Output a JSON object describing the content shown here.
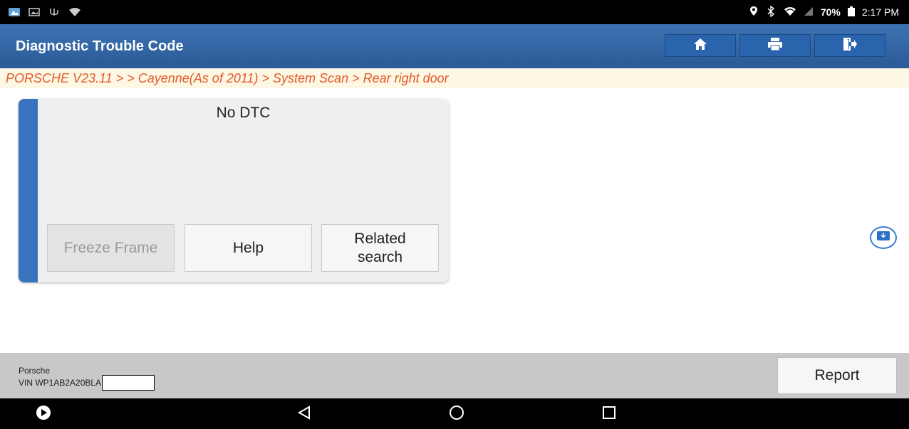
{
  "status_bar": {
    "battery": "70%",
    "time": "2:17 PM"
  },
  "title_bar": {
    "title": "Diagnostic Trouble Code",
    "buttons": [
      "home-icon",
      "print-icon",
      "exit-icon"
    ]
  },
  "breadcrumb": {
    "text": "PORSCHE V23.11 >  > Cayenne(As of 2011) > System Scan > Rear right door"
  },
  "dtc_card": {
    "title": "No DTC",
    "buttons": {
      "freeze_frame": "Freeze Frame",
      "help": "Help",
      "related_search": "Related search"
    },
    "accent_color": "#3a73bd"
  },
  "footer": {
    "make": "Porsche",
    "vin_prefix": "VIN WP1AB2A20BLA",
    "report_label": "Report"
  },
  "colors": {
    "title_bar": "#2f63a3",
    "breadcrumb_text": "#e2592b",
    "breadcrumb_bg": "#fdf7e3"
  }
}
